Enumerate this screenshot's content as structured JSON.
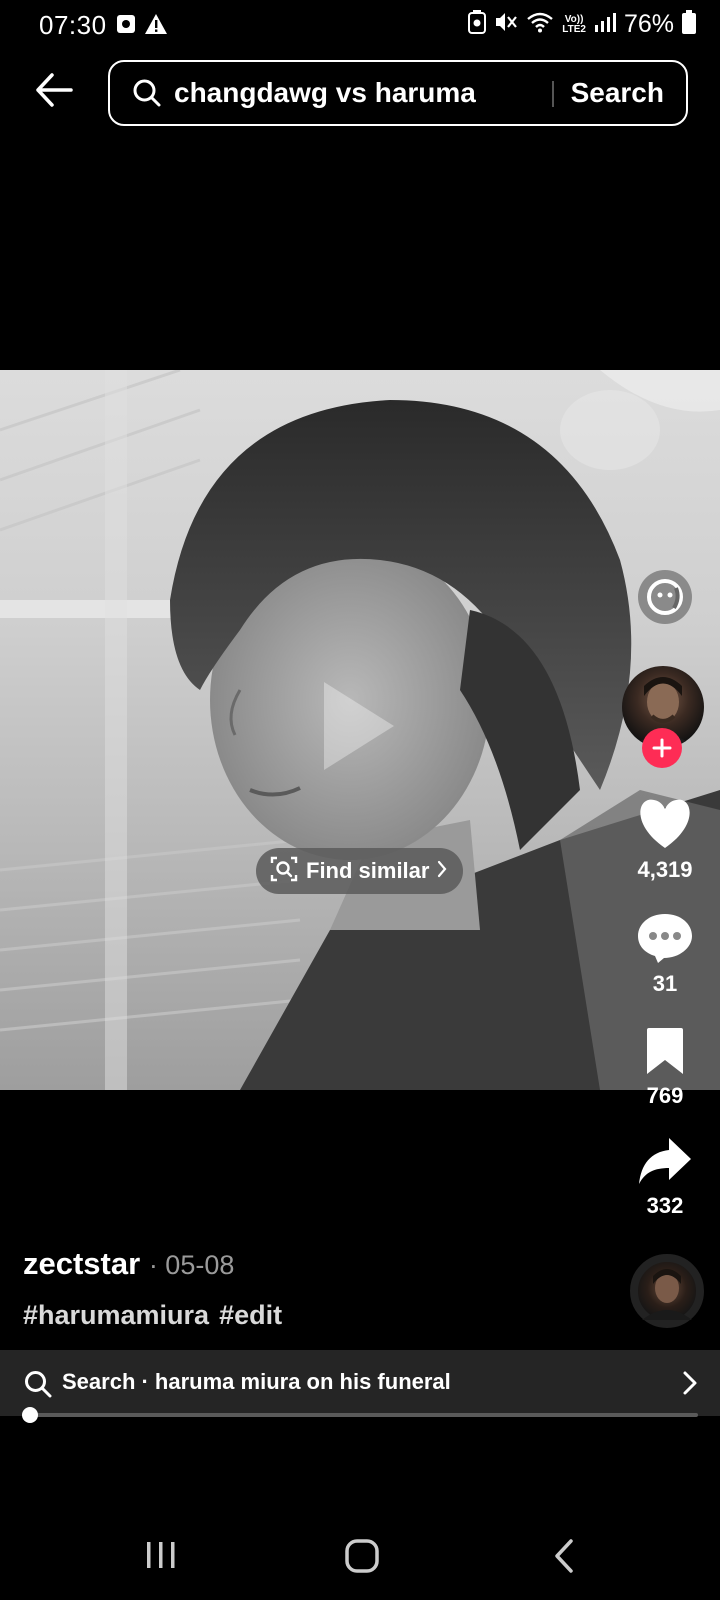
{
  "status_bar": {
    "time": "07:30",
    "network_label_top": "Vo))",
    "network_label_bottom": "LTE2",
    "battery_percent": "76%"
  },
  "search": {
    "query": "changdawg vs haruma",
    "submit_label": "Search"
  },
  "video": {
    "find_similar_label": "Find similar"
  },
  "actions": {
    "likes": "4,319",
    "comments": "31",
    "bookmarks": "769",
    "shares": "332"
  },
  "post": {
    "author": "zectstar",
    "date": "· 05-08",
    "hashtags": [
      "#harumamiura",
      "#edit"
    ]
  },
  "related_search": {
    "label": "Search · haruma miura on his funeral"
  },
  "playback": {
    "progress_fraction": 0.0
  },
  "colors": {
    "follow_accent": "#fe2c55",
    "background": "#000000",
    "related_bar_bg": "#252525"
  }
}
